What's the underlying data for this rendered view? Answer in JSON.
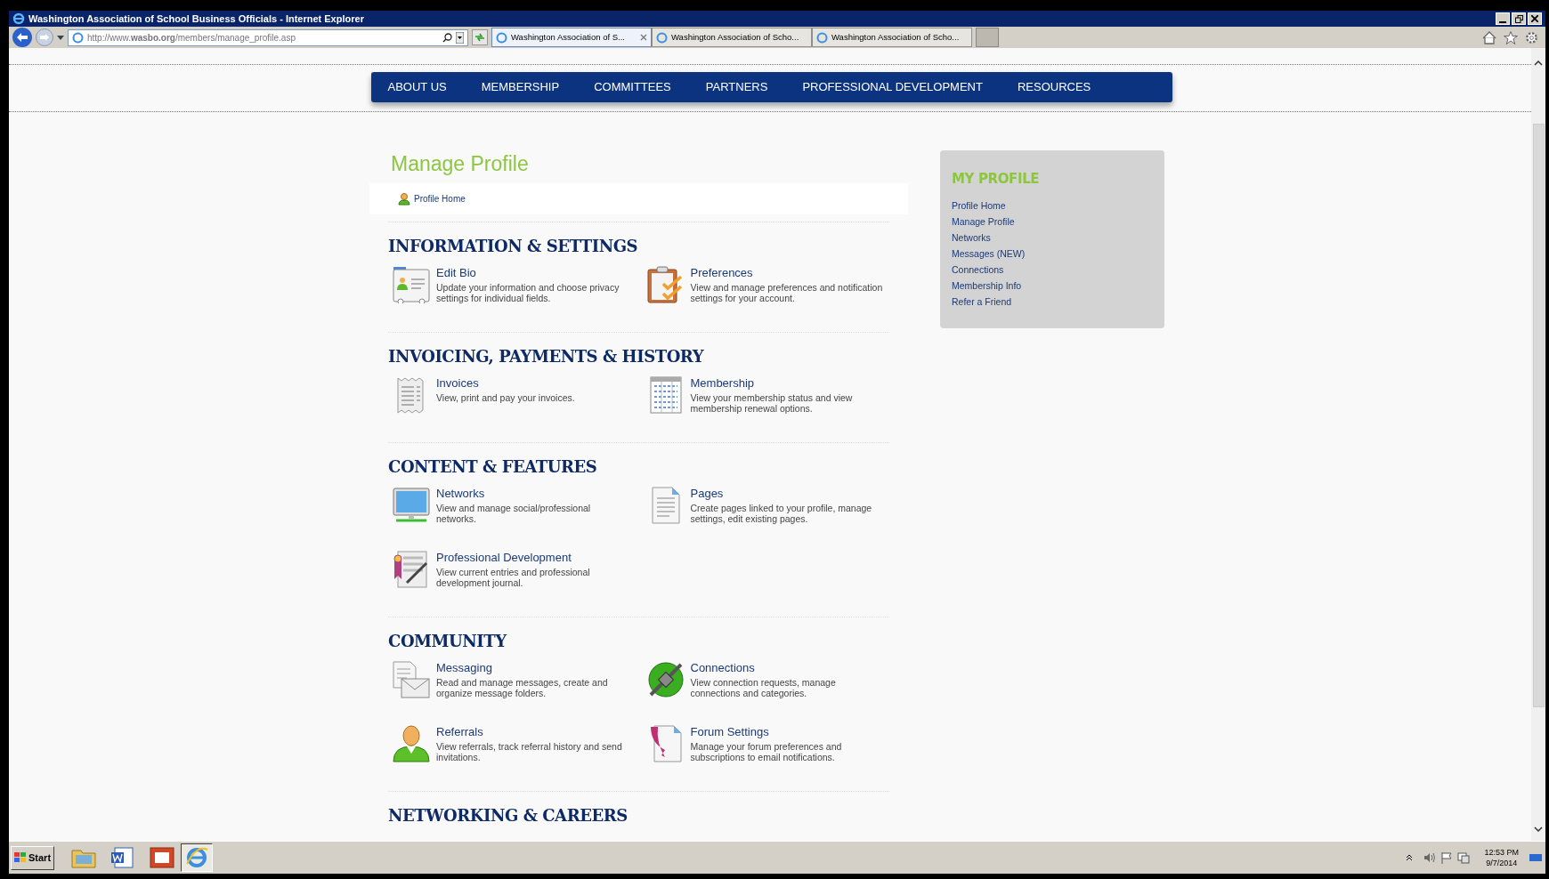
{
  "window": {
    "title": "Washington Association of School Business Officials - Internet Explorer"
  },
  "address_bar": {
    "url": "http://www.**wasbo.org**/members/manage_profile.asp"
  },
  "browser_tabs": [
    {
      "label": "Washington Association of S...",
      "selected": true
    },
    {
      "label": "Washington Association of Scho...",
      "selected": false
    },
    {
      "label": "Washington Association of Scho...",
      "selected": false
    }
  ],
  "nav": [
    "ABOUT US",
    "MEMBERSHIP",
    "COMMITTEES",
    "PARTNERS",
    "PROFESSIONAL DEVELOPMENT",
    "RESOURCES"
  ],
  "page_title": "Manage Profile",
  "breadcrumb": "Profile Home",
  "sections": [
    {
      "heading": "INFORMATION & SETTINGS",
      "items": [
        {
          "kind": "card",
          "title": "Edit Bio",
          "description": "Update your information and choose privacy settings for individual fields."
        },
        {
          "kind": "clipboard",
          "title": "Preferences",
          "description": "View and manage preferences and notification settings for your account."
        }
      ]
    },
    {
      "heading": "INVOICING, PAYMENTS & HISTORY",
      "items": [
        {
          "kind": "receipt",
          "title": "Invoices",
          "description": "View, print and pay your invoices."
        },
        {
          "kind": "table",
          "title": "Membership",
          "description": "View your membership status and view membership renewal options."
        }
      ]
    },
    {
      "heading": "CONTENT & FEATURES",
      "items": [
        {
          "kind": "monitor",
          "title": "Networks",
          "description": "View and manage social/professional networks."
        },
        {
          "kind": "document",
          "title": "Pages",
          "description": "Create pages linked to your profile, manage settings, edit existing pages."
        },
        {
          "kind": "certificate",
          "title": "Professional Development",
          "description": "View current entries and professional development journal."
        }
      ]
    },
    {
      "heading": "COMMUNITY",
      "items": [
        {
          "kind": "mail",
          "title": "Messaging",
          "description": "Read and manage messages, create and organize message folders."
        },
        {
          "kind": "plug",
          "title": "Connections",
          "description": "View connection requests, manage connections and categories."
        },
        {
          "kind": "person",
          "title": "Referrals",
          "description": "View referrals, track referral history and send invitations."
        },
        {
          "kind": "ribbon",
          "title": "Forum Settings",
          "description": "Manage your forum preferences and subscriptions to email notifications."
        }
      ]
    },
    {
      "heading": "NETWORKING & CAREERS"
    }
  ],
  "sidebar": {
    "title": "MY PROFILE",
    "links": [
      "Profile Home",
      "Manage Profile",
      "Networks",
      "Messages (NEW)",
      "Connections",
      "Membership Info",
      "Refer a Friend"
    ]
  },
  "taskbar": {
    "start": "Start",
    "time": "12:53 PM",
    "date": "9/7/2014"
  }
}
